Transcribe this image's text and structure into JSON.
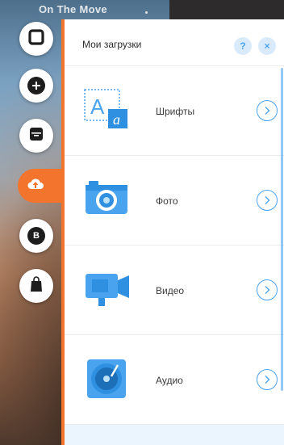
{
  "topbar": {
    "site_title": "On The Move"
  },
  "toolbar": {
    "items": [
      {
        "icon": "square-outline-icon",
        "active": false
      },
      {
        "icon": "plus-icon",
        "active": false
      },
      {
        "icon": "archive-box-icon",
        "active": false
      },
      {
        "icon": "cloud-upload-icon",
        "active": true
      },
      {
        "icon": "blog-b-icon",
        "active": false
      },
      {
        "icon": "shopping-bag-icon",
        "active": false
      }
    ],
    "accent_color": "#f3742c"
  },
  "panel": {
    "title": "Мои загрузки",
    "help_label": "?",
    "close_label": "×",
    "items": [
      {
        "label": "Шрифты",
        "icon": "font-icon"
      },
      {
        "label": "Фото",
        "icon": "camera-icon"
      },
      {
        "label": "Видео",
        "icon": "video-camera-icon"
      },
      {
        "label": "Аудио",
        "icon": "vinyl-record-icon"
      }
    ],
    "accent_color": "#4aa3ee"
  }
}
